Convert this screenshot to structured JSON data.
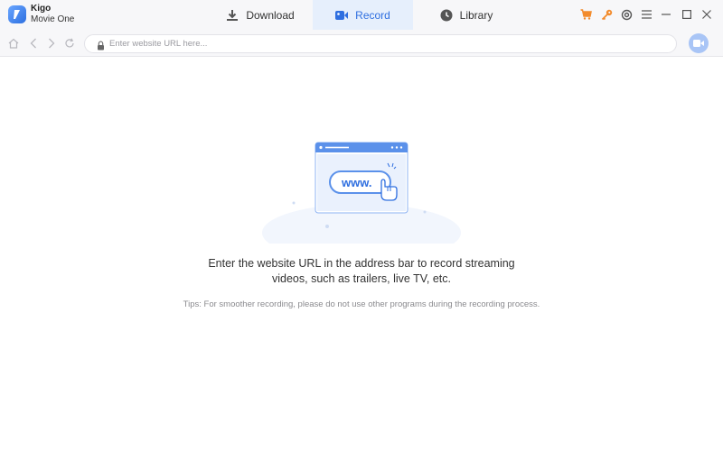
{
  "app": {
    "name_line1": "Kigo",
    "name_line2": "Movie One"
  },
  "tabs": [
    {
      "label": "Download",
      "icon": "download-icon",
      "active": false
    },
    {
      "label": "Record",
      "icon": "record-icon",
      "active": true
    },
    {
      "label": "Library",
      "icon": "clock-icon",
      "active": false
    }
  ],
  "titlebar_icons": [
    "cart-icon",
    "key-icon",
    "settings-icon",
    "menu-icon",
    "minimize-icon",
    "maximize-icon",
    "close-icon"
  ],
  "colors": {
    "accent": "#2f6fe0",
    "active_tab_bg": "#e6effc",
    "orange_icon": "#f28b2c"
  },
  "nav": {
    "url_placeholder": "Enter website URL here...",
    "url_value": ""
  },
  "illustration": {
    "url_text": "www."
  },
  "main": {
    "message_line1": "Enter the website URL in the address bar to record streaming",
    "message_line2": "videos, such as trailers, live TV, etc.",
    "tips": "Tips: For smoother recording, please do not use other programs during the recording process."
  }
}
